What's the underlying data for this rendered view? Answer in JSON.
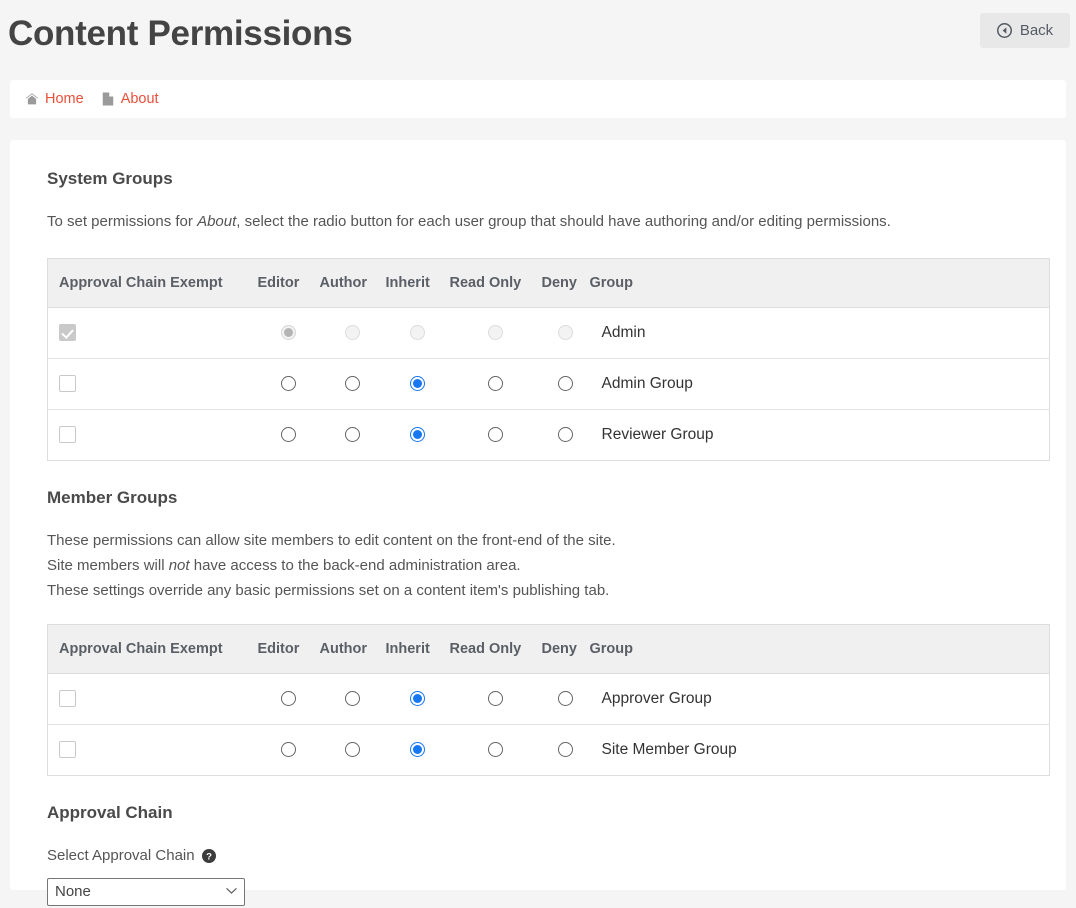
{
  "header": {
    "title": "Content Permissions",
    "back_label": "Back",
    "back_icon": "circle-arrow-left-icon"
  },
  "breadcrumb": {
    "items": [
      {
        "label": "Home",
        "icon": "home-icon"
      },
      {
        "label": "About",
        "icon": "file-icon"
      }
    ]
  },
  "colors": {
    "link": "#e8503a",
    "radio_selected": "#1877f2",
    "page_background": "#f5f5f5",
    "panel_background": "#ffffff",
    "table_header_background": "#f0f0f0",
    "title_text": "#444444"
  },
  "system_groups": {
    "title": "System Groups",
    "description_prefix": "To set permissions for ",
    "description_emphasis": "About",
    "description_suffix": ", select the radio button for each user group that should have authoring and/or editing permissions.",
    "columns": [
      "Approval Chain Exempt",
      "Editor",
      "Author",
      "Inherit",
      "Read Only",
      "Deny",
      "Group"
    ],
    "rows": [
      {
        "group": "Admin",
        "exempt_checked": true,
        "disabled": true,
        "selected": "Editor"
      },
      {
        "group": "Admin Group",
        "exempt_checked": false,
        "disabled": false,
        "selected": "Inherit"
      },
      {
        "group": "Reviewer Group",
        "exempt_checked": false,
        "disabled": false,
        "selected": "Inherit"
      }
    ]
  },
  "member_groups": {
    "title": "Member Groups",
    "description_line1": "These permissions can allow site members to edit content on the front-end of the site.",
    "description_line2_prefix": "Site members will ",
    "description_line2_emphasis": "not",
    "description_line2_suffix": " have access to the back-end administration area.",
    "description_line3": "These settings override any basic permissions set on a content item's publishing tab.",
    "columns": [
      "Approval Chain Exempt",
      "Editor",
      "Author",
      "Inherit",
      "Read Only",
      "Deny",
      "Group"
    ],
    "rows": [
      {
        "group": "Approver Group",
        "exempt_checked": false,
        "disabled": false,
        "selected": "Inherit"
      },
      {
        "group": "Site Member Group",
        "exempt_checked": false,
        "disabled": false,
        "selected": "Inherit"
      }
    ]
  },
  "approval_chain": {
    "title": "Approval Chain",
    "select_label": "Select Approval Chain",
    "help_icon": "question-circle-icon",
    "selected_value": "None",
    "options": [
      "None"
    ]
  }
}
